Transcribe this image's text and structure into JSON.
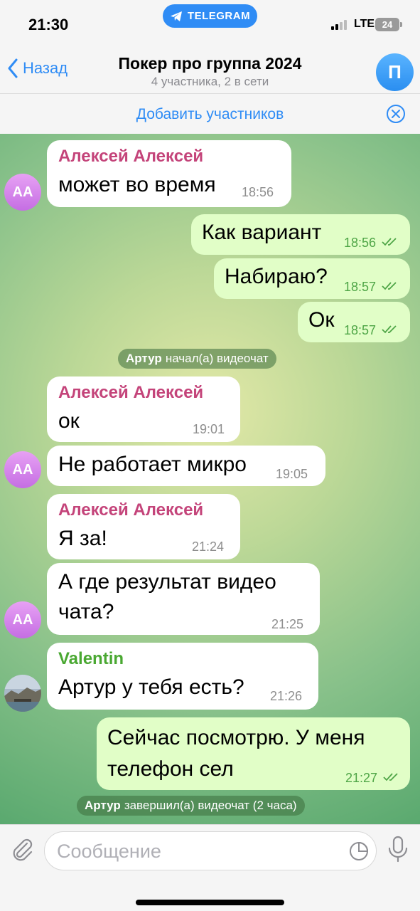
{
  "status": {
    "time": "21:30",
    "pill": "TELEGRAM",
    "network": "LTE",
    "battery": "24"
  },
  "header": {
    "back_label": "Назад",
    "title": "Покер про группа 2024",
    "subtitle": "4 участника, 2 в сети",
    "avatar_letter": "П"
  },
  "add_members": {
    "label": "Добавить участников"
  },
  "messages": [
    {
      "sender": "Алексей Алексей",
      "text": "может во время",
      "time": "18:56"
    },
    {
      "text": "Как вариант",
      "time": "18:56"
    },
    {
      "text": "Набираю?",
      "time": "18:57"
    },
    {
      "text": "Ок",
      "time": "18:57"
    },
    {
      "sender": "Алексей Алексей",
      "text": "ок",
      "time": "19:01"
    },
    {
      "text": "Не работает микро",
      "time": "19:05"
    },
    {
      "sender": "Алексей Алексей",
      "text": "Я за!",
      "time": "21:24"
    },
    {
      "text_line1": "А где результат видео",
      "text_line2": "чата?",
      "time": "21:25"
    },
    {
      "sender": "Valentin",
      "text": "Артур у тебя есть?",
      "time": "21:26"
    },
    {
      "text_line1": "Сейчас посмотрю. У меня",
      "text_line2": "телефон сел",
      "time": "21:27"
    }
  ],
  "service": [
    {
      "name": "Артур",
      "text": "начал(а) видеочат"
    },
    {
      "name": "Артур",
      "text": "завершил(а) видеочат (2 часа)"
    }
  ],
  "avatars": {
    "aa_initials": "АА"
  },
  "colors": {
    "accent": "#2f8cf5",
    "sender_alexey": "#c4447a",
    "sender_valentin": "#4aa832",
    "outgoing_bubble": "#e1fec7"
  },
  "input": {
    "placeholder": "Сообщение"
  }
}
